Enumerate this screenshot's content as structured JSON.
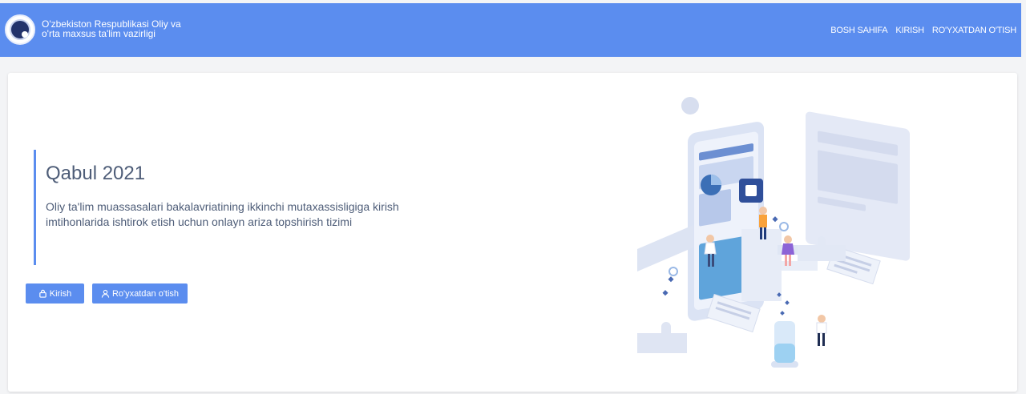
{
  "header": {
    "ministry_line1": "O'zbekiston Respublikasi Oliy va",
    "ministry_line2": "o'rta maxsus ta'lim vazirligi",
    "nav": [
      {
        "label": "BOSH SAHIFA"
      },
      {
        "label": "KIRISH"
      },
      {
        "label": "RO'YXATDAN O'TISH"
      }
    ]
  },
  "hero": {
    "title": "Qabul 2021",
    "description": "Oliy ta'lim muassasalari bakalavriatining ikkinchi mutaxassisligiga kirish imtihonlarida ishtirok etish uchun onlayn ariza topshirish tizimi"
  },
  "buttons": {
    "login": "Kirish",
    "register": "Ro'yxatdan o'tish"
  },
  "icons": {
    "login": "lock-icon",
    "register": "user-icon"
  },
  "colors": {
    "brand": "#5b8def",
    "text": "#4e5d78"
  }
}
